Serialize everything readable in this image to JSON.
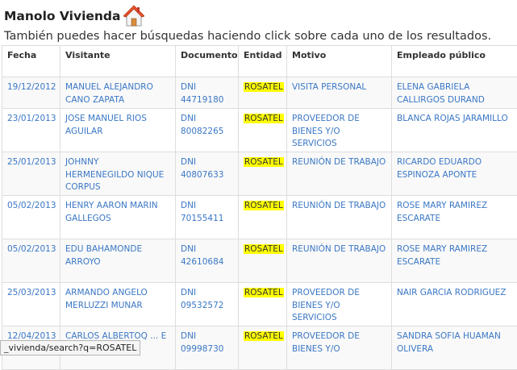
{
  "header": {
    "title": "Manolo Vivienda",
    "subtitle": "También puedes hacer búsquedas haciendo click sobre cada uno de los resultados."
  },
  "table": {
    "columns": [
      "Fecha",
      "Visitante",
      "Documento",
      "Entidad",
      "Motivo",
      "Empleado público"
    ],
    "rows": [
      {
        "fecha": "19/12/2012",
        "visitante": "MANUEL ALEJANDRO CANO ZAPATA",
        "documento": "DNI 44719180",
        "entidad": "ROSATEL",
        "motivo": "VISITA PERSONAL",
        "empleado": "ELENA GABRIELA CALLIRGOS DURAND"
      },
      {
        "fecha": "23/01/2013",
        "visitante": "JOSE MANUEL RIOS AGUILAR",
        "documento": "DNI 80082265",
        "entidad": "ROSATEL",
        "motivo": "PROVEEDOR DE BIENES Y/O SERVICIOS",
        "empleado": "BLANCA ROJAS JARAMILLO"
      },
      {
        "fecha": "25/01/2013",
        "visitante": "JOHNNY HERMENEGILDO NIQUE CORPUS",
        "documento": "DNI 40807633",
        "entidad": "ROSATEL",
        "motivo": "REUNIÓN DE TRABAJO",
        "empleado": "RICARDO EDUARDO ESPINOZA APONTE"
      },
      {
        "fecha": "05/02/2013",
        "visitante": "HENRY AARON MARIN GALLEGOS",
        "documento": "DNI 70155411",
        "entidad": "ROSATEL",
        "motivo": "REUNIÓN DE TRABAJO",
        "empleado": "ROSE MARY RAMIREZ ESCARATE"
      },
      {
        "fecha": "05/02/2013",
        "visitante": "EDU BAHAMONDE ARROYO",
        "documento": "DNI 42610684",
        "entidad": "ROSATEL",
        "motivo": "REUNIÓN DE TRABAJO",
        "empleado": "ROSE MARY RAMIREZ ESCARATE"
      },
      {
        "fecha": "25/03/2013",
        "visitante": "ARMANDO ANGELO MERLUZZI MUNAR",
        "documento": "DNI 09532572",
        "entidad": "ROSATEL",
        "motivo": "PROVEEDOR DE BIENES Y/O SERVICIOS",
        "empleado": "NAIR GARCIA RODRIGUEZ"
      },
      {
        "fecha": "12/04/2013",
        "visitante": "CARLOS ALBERTOQ ... E",
        "documento": "DNI 09998730",
        "entidad": "ROSATEL",
        "motivo": "PROVEEDOR DE BIENES Y/O",
        "empleado": "SANDRA SOFIA HUAMAN OLIVERA"
      }
    ]
  },
  "status_bar": {
    "text": "_vivienda/search?q=ROSATEL"
  },
  "icons": {
    "house": "house-icon"
  }
}
